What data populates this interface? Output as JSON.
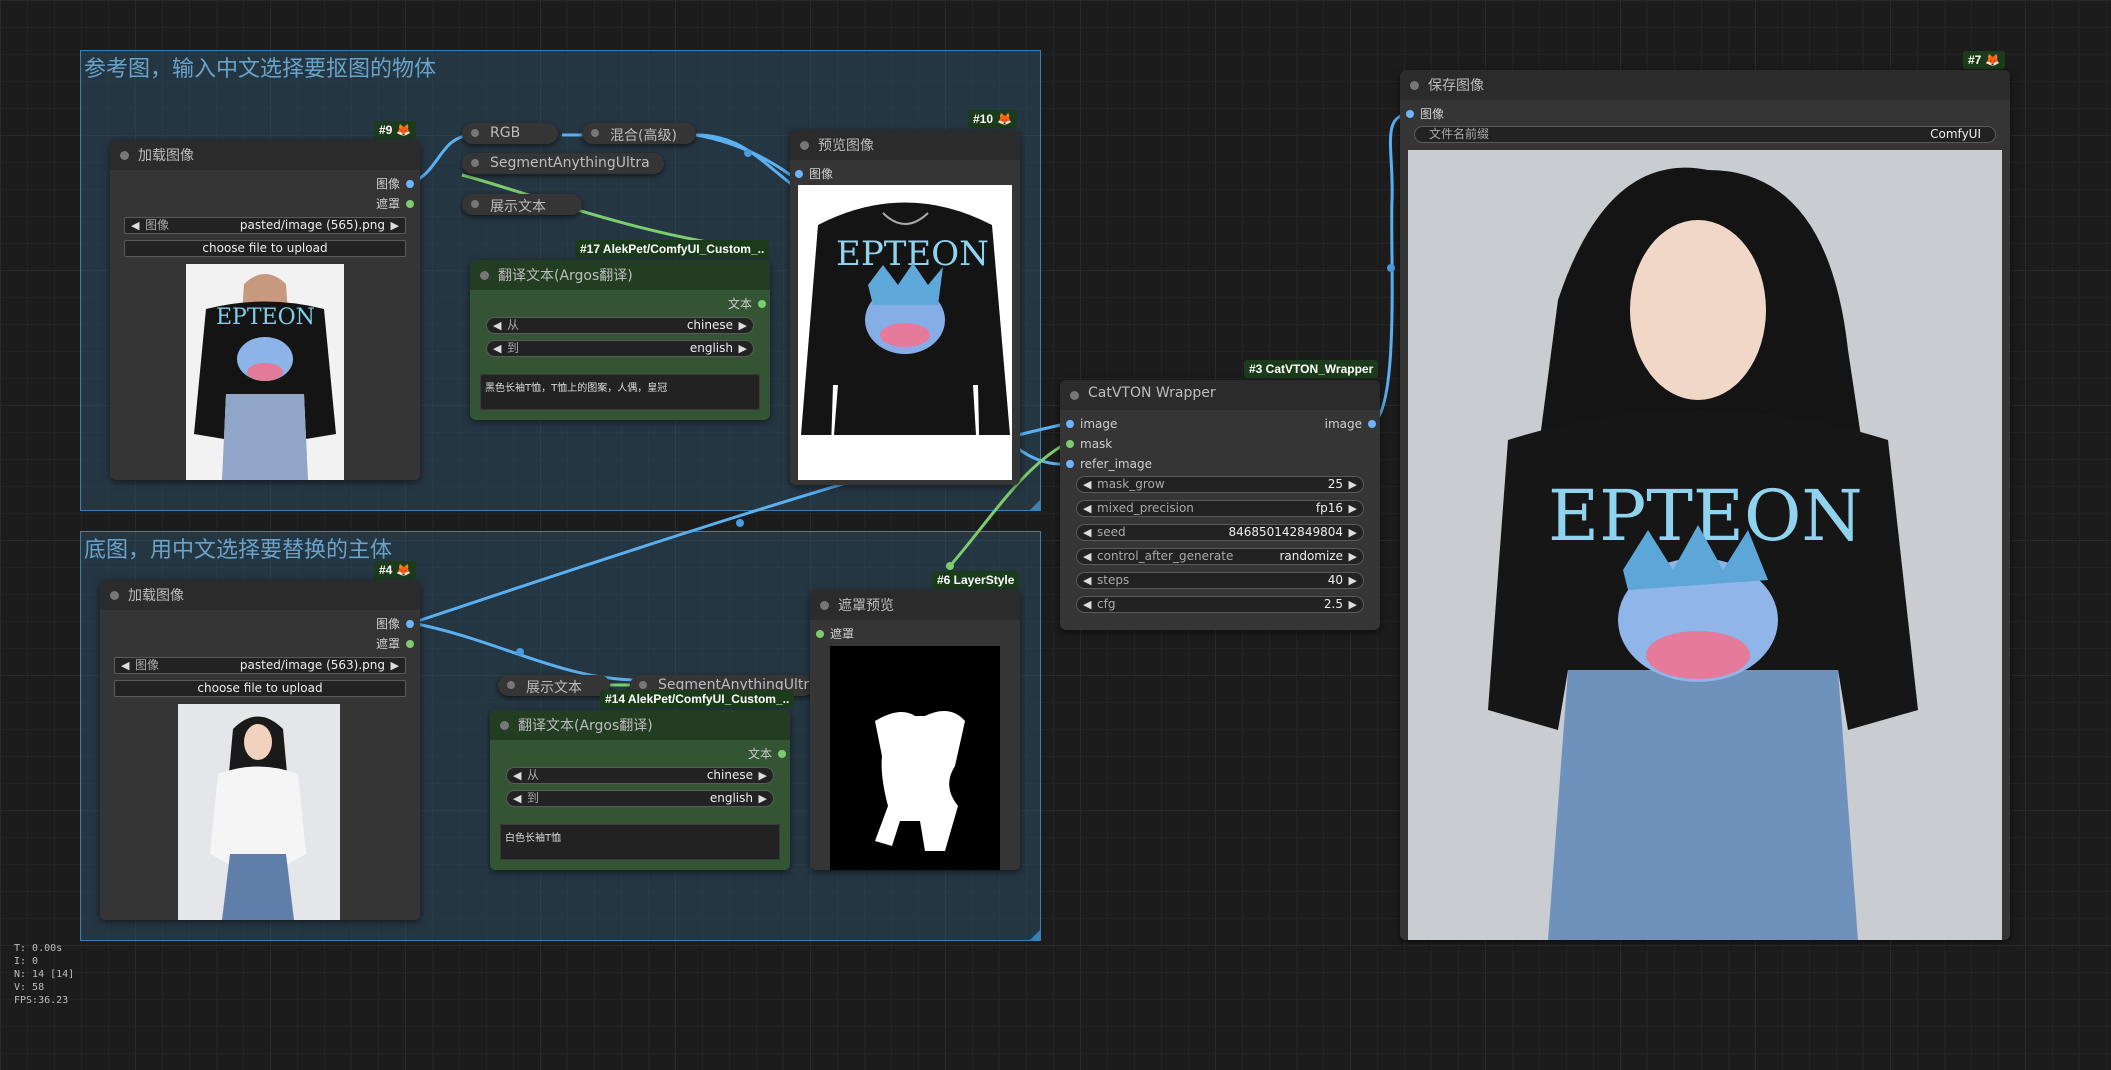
{
  "groups": {
    "reference": {
      "title": "参考图，输入中文选择要抠图的物体"
    },
    "base": {
      "title": "底图，用中文选择要替换的主体"
    }
  },
  "load_ref": {
    "badge": "#9",
    "title": "加载图像",
    "out1": "图像",
    "out2": "遮罩",
    "widget_label": "图像",
    "widget_value": "pasted/image (565).png",
    "upload": "choose file to upload"
  },
  "rgb": {
    "title": "RGB"
  },
  "mix": {
    "title": "混合(高级)"
  },
  "seg_ref": {
    "title": "SegmentAnythingUltra"
  },
  "show_text_ref": {
    "title": "展示文本"
  },
  "translate_ref": {
    "badge": "#17 AlekPet/ComfyUI_Custom_..",
    "title": "翻译文本(Argos翻译)",
    "out": "文本",
    "from_label": "从",
    "from_value": "chinese",
    "to_label": "到",
    "to_value": "english",
    "text": "黑色长袖T恤，T恤上的图案，人偶，皇冠"
  },
  "preview": {
    "badge": "#10",
    "title": "预览图像",
    "in": "图像"
  },
  "load_base": {
    "badge": "#4",
    "title": "加载图像",
    "out1": "图像",
    "out2": "遮罩",
    "widget_label": "图像",
    "widget_value": "pasted/image (563).png",
    "upload": "choose file to upload"
  },
  "show_text_base": {
    "title": "展示文本"
  },
  "seg_base": {
    "title": "SegmentAnythingUltra"
  },
  "translate_base": {
    "badge": "#14 AlekPet/ComfyUI_Custom_..",
    "title": "翻译文本(Argos翻译)",
    "out": "文本",
    "from_label": "从",
    "from_value": "chinese",
    "to_label": "到",
    "to_value": "english",
    "text": "白色长袖T恤"
  },
  "mask_preview": {
    "badge": "#6 LayerStyle",
    "title": "遮罩预览",
    "in": "遮罩"
  },
  "catvton": {
    "badge": "#3 CatVTON_Wrapper",
    "title": "CatVTON Wrapper",
    "in1": "image",
    "in2": "mask",
    "in3": "refer_image",
    "out": "image",
    "widgets": [
      {
        "label": "mask_grow",
        "value": "25"
      },
      {
        "label": "mixed_precision",
        "value": "fp16"
      },
      {
        "label": "seed",
        "value": "846850142849804"
      },
      {
        "label": "control_after_generate",
        "value": "randomize"
      },
      {
        "label": "steps",
        "value": "40"
      },
      {
        "label": "cfg",
        "value": "2.5"
      }
    ]
  },
  "save": {
    "badge": "#7",
    "title": "保存图像",
    "in": "图像",
    "prefix_label": "文件名前缀",
    "prefix_value": "ComfyUI"
  },
  "help": "?",
  "fox": "🦊",
  "stats": [
    "T: 0.00s",
    "I: 0",
    "N: 14 [14]",
    "V: 58",
    "FPS:36.23"
  ]
}
